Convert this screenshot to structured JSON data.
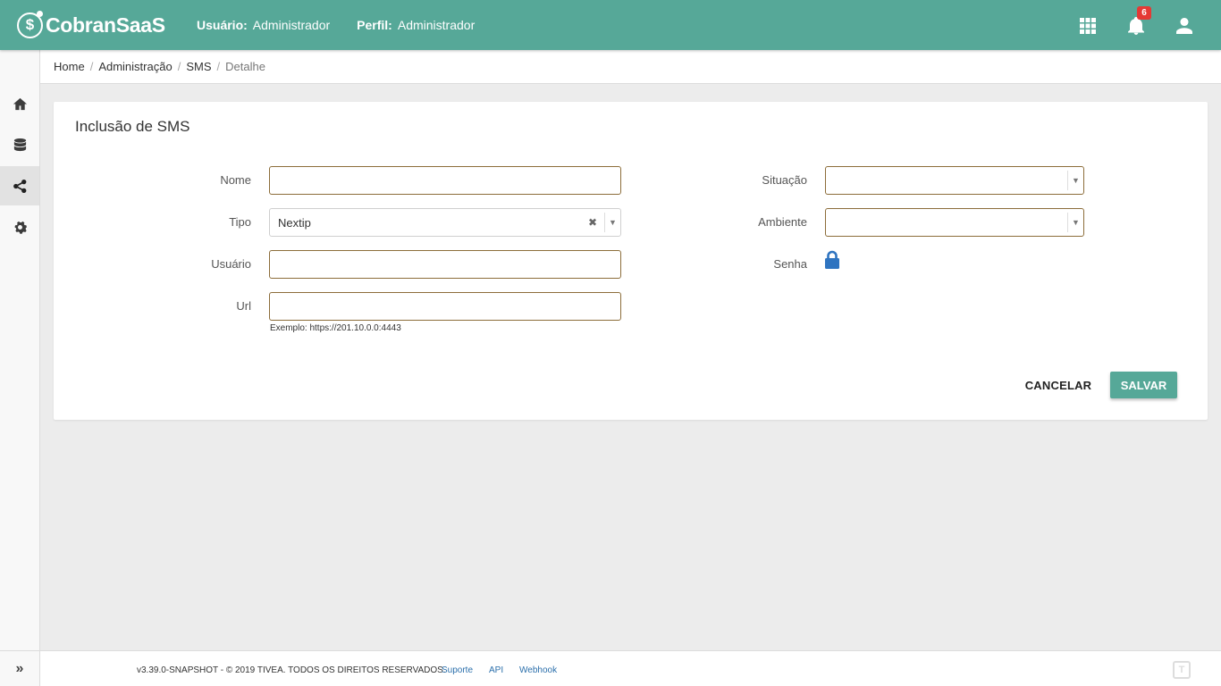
{
  "app": {
    "logo_symbol": "$",
    "logo_text": "CobranSaaS",
    "user_label": "Usuário:",
    "user_value": "Administrador",
    "profile_label": "Perfil:",
    "profile_value": "Administrador",
    "notification_count": "6",
    "accent_color": "#56a898"
  },
  "sidebar": {
    "items": [
      {
        "icon": "home-icon"
      },
      {
        "icon": "database-icon"
      },
      {
        "icon": "share-icon",
        "active": true
      },
      {
        "icon": "gear-icon"
      }
    ],
    "expand_symbol": "»"
  },
  "breadcrumb": {
    "items": [
      "Home",
      "Administração",
      "SMS"
    ],
    "current": "Detalhe",
    "separator": "/"
  },
  "form": {
    "title": "Inclusão de SMS",
    "nome": {
      "label": "Nome",
      "value": ""
    },
    "tipo": {
      "label": "Tipo",
      "value": "Nextip"
    },
    "usuario": {
      "label": "Usuário",
      "value": ""
    },
    "url": {
      "label": "Url",
      "value": "",
      "hint": "Exemplo: https://201.10.0.0:4443"
    },
    "situacao": {
      "label": "Situação",
      "value": ""
    },
    "ambiente": {
      "label": "Ambiente",
      "value": ""
    },
    "senha": {
      "label": "Senha",
      "icon": "lock-icon"
    },
    "cancel_label": "CANCELAR",
    "save_label": "SALVAR"
  },
  "footer": {
    "copyright": "v3.39.0-SNAPSHOT - © 2019 TIVEA. TODOS OS DIREITOS RESERVADOS.",
    "links": [
      "Suporte",
      "API",
      "Webhook"
    ]
  }
}
